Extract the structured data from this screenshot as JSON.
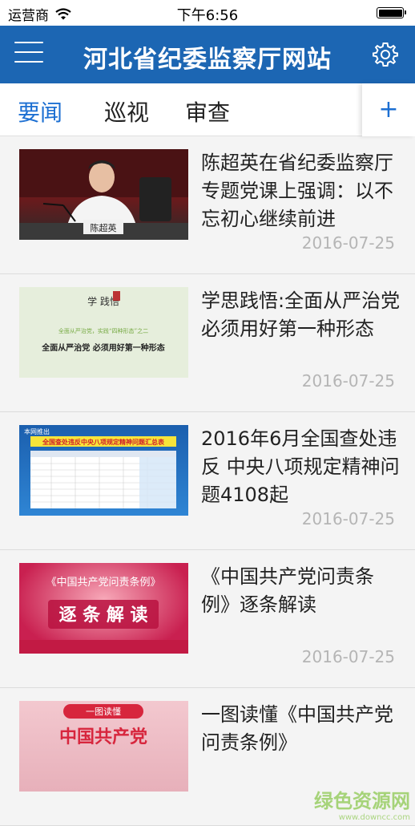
{
  "status_bar": {
    "carrier": "运营商",
    "time": "下午6:56",
    "battery_level": 1.0
  },
  "nav": {
    "title": "河北省纪委监察厅网站"
  },
  "tabs": [
    {
      "label": "要闻",
      "active": true
    },
    {
      "label": "巡视",
      "active": false
    },
    {
      "label": "审查",
      "active": false
    }
  ],
  "tab_add_label": "+",
  "news": [
    {
      "title": "陈超英在省纪委监察厅专题党课上强调：以不忘初心继续前进",
      "date": "2016-07-25",
      "thumb_caption": "陈超英"
    },
    {
      "title": "学思践悟:全面从严治党 必须用好第一种形态",
      "date": "2016-07-25",
      "thumb_caption": "全面从严治党 必须用好第一种形态",
      "thumb_top": "学 践悟",
      "thumb_sub": "全面从严治党，实践“四种形态”之二"
    },
    {
      "title": "2016年6月全国查处违反 中央八项规定精神问题4108起",
      "date": "2016-07-25",
      "thumb_caption": "全国查处违反中央八项规定精神问题汇总表",
      "thumb_top": "本网推出"
    },
    {
      "title": "《中国共产党问责条例》逐条解读",
      "date": "2016-07-25",
      "thumb_caption": "逐 条 解 读",
      "thumb_top": "《中国共产党问责条例》"
    },
    {
      "title": "一图读懂《中国共产党问责条例》",
      "date": "",
      "thumb_top": "一图读懂",
      "thumb_caption": "中国共产党"
    }
  ],
  "watermark": {
    "text": "绿色资源网",
    "url_text": "www.downcc.com"
  },
  "colors": {
    "nav_bg": "#1c66b3",
    "tab_active": "#1c6fd2",
    "date_gray": "#b5b5b5"
  }
}
